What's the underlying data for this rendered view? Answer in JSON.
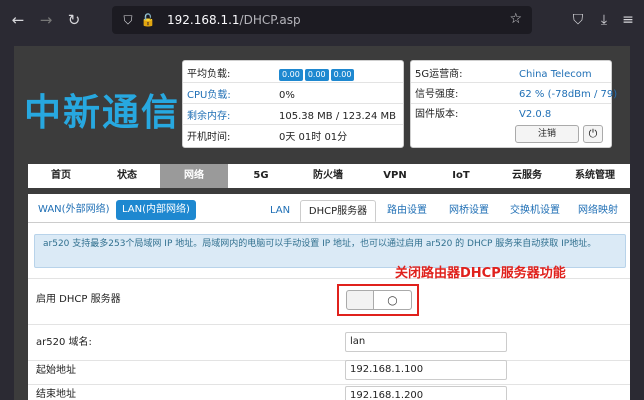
{
  "browser": {
    "url_host": "192.168.1.1",
    "url_path": "/DHCP.asp",
    "icons": [
      "back-arrow-icon",
      "forward-arrow-icon",
      "reload-icon",
      "shield-icon",
      "insecure-lock-icon",
      "star-icon",
      "pocket-icon",
      "download-icon",
      "menu-icon"
    ]
  },
  "header": {
    "logo": "中新通信"
  },
  "status_left": {
    "rows": [
      {
        "label": "平均负载:",
        "chips": [
          "0.00",
          "0.00",
          "0.00"
        ]
      },
      {
        "label": "CPU负载:",
        "value": "0%"
      },
      {
        "label": "剩余内存:",
        "value": "105.38 MB / 123.24 MB"
      },
      {
        "label": "开机时间:",
        "value": "0天 01时 01分"
      }
    ]
  },
  "status_right": {
    "rows": [
      {
        "label": "5G运营商:",
        "value": "China Telecom"
      },
      {
        "label": "信号强度:",
        "value": "62 % (-78dBm / 79)"
      },
      {
        "label": "固件版本:",
        "value": "V2.0.8"
      }
    ],
    "logout_label": "注销",
    "power_icon": "power-icon"
  },
  "mainnav": {
    "items": [
      "首页",
      "状态",
      "网络",
      "5G",
      "防火墙",
      "VPN",
      "IoT",
      "云服务",
      "系统管理"
    ],
    "active": "网络"
  },
  "subtabs": {
    "left": [
      "WAN(外部网络)",
      "LAN(内部网络)"
    ],
    "left_active": "LAN(内部网络)",
    "right": [
      "LAN",
      "DHCP服务器",
      "路由设置",
      "网桥设置",
      "交换机设置",
      "网络映射"
    ],
    "right_active": "DHCP服务器"
  },
  "info": {
    "text": "ar520 支持最多253个局域网 IP 地址。局域网内的电脑可以手动设置 IP 地址，也可以通过启用 ar520 的 DHCP 服务来自动获取 IP地址。"
  },
  "form": {
    "enable_dhcp_label": "启用 DHCP 服务器",
    "enable_dhcp_state": "off",
    "domain_label": "ar520 域名:",
    "domain_value": "lan",
    "start_label": "起始地址",
    "start_value": "192.168.1.100",
    "end_label": "结束地址",
    "end_value": "192.168.1.200"
  },
  "annotation": "关闭路由器DHCP服务器功能",
  "colors": {
    "accent": "#1e88d0",
    "logo": "#27a8e0",
    "annotation": "#e0211c",
    "active_nav": "#9a9a9a"
  }
}
